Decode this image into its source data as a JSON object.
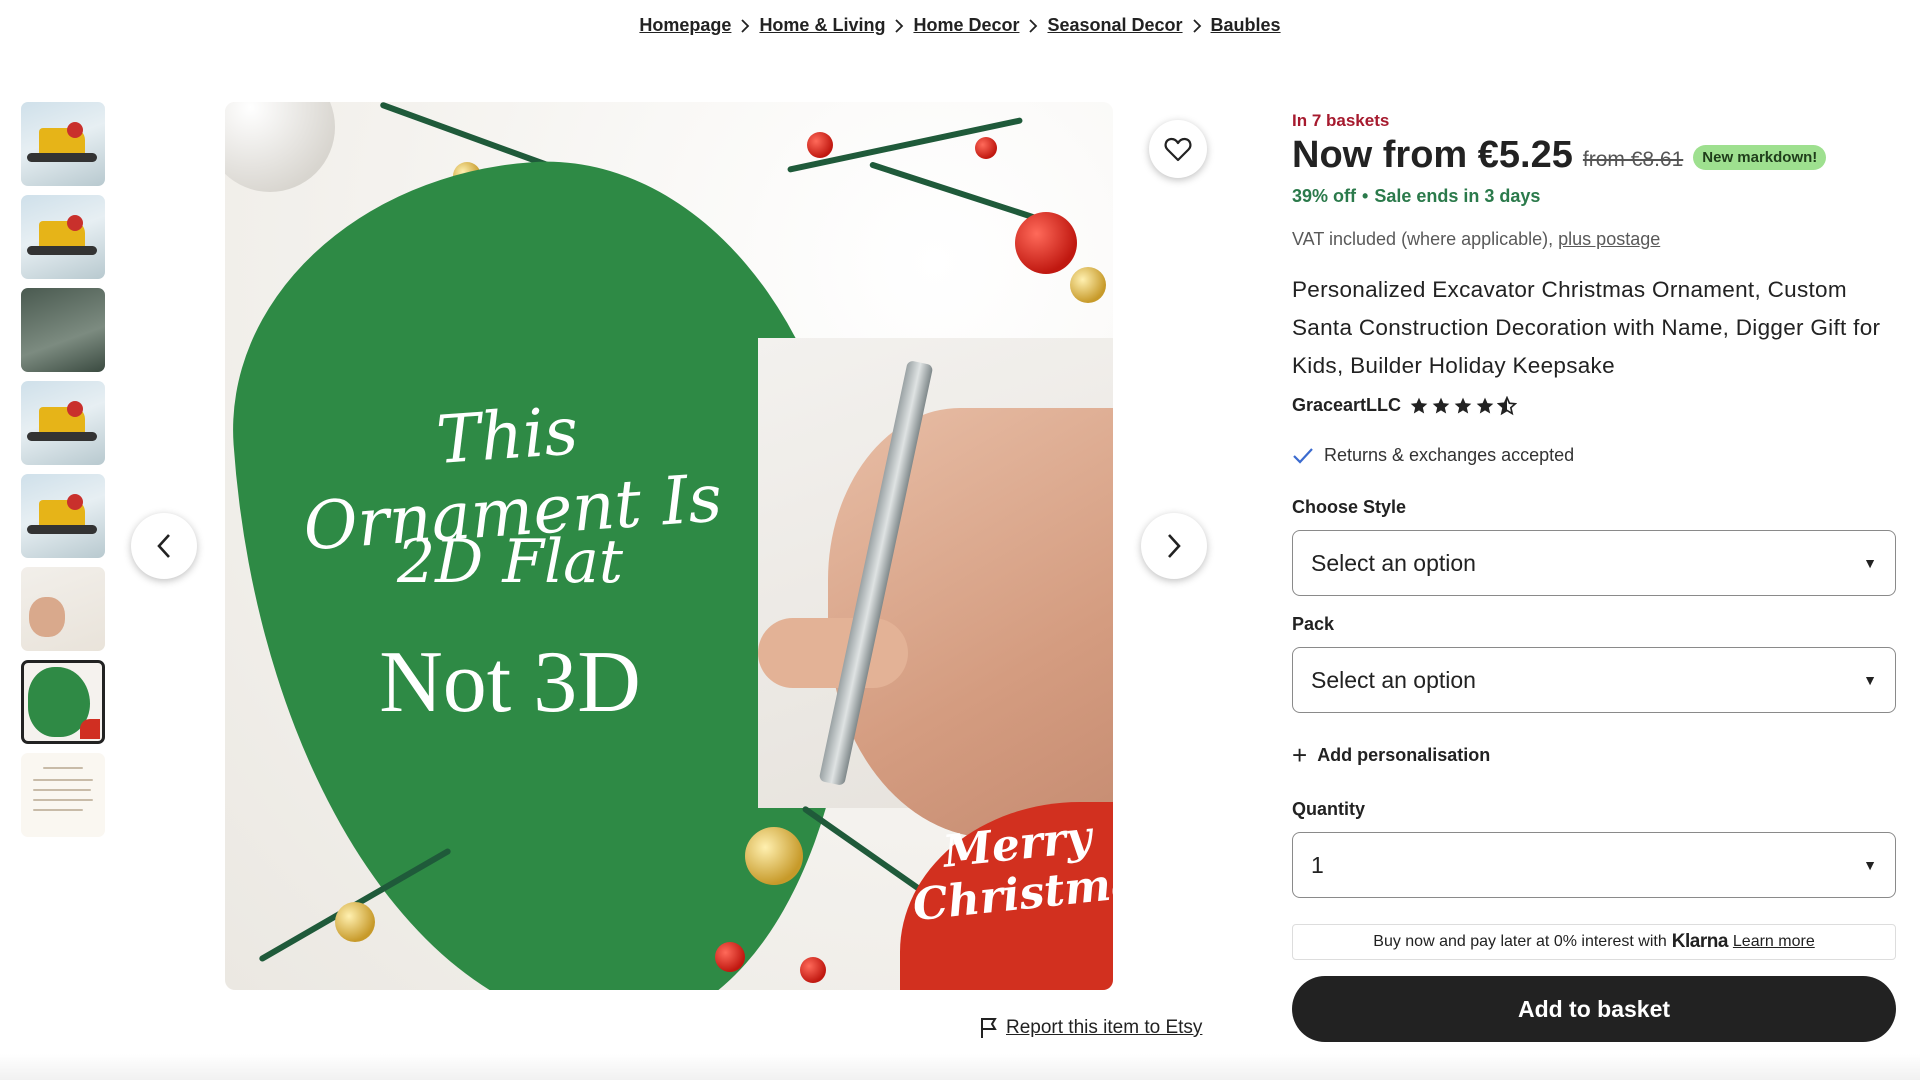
{
  "breadcrumb": [
    "Homepage",
    "Home & Living",
    "Home Decor",
    "Seasonal Decor",
    "Baubles"
  ],
  "gallery": {
    "thumbnail_count": 8,
    "selected_index": 7,
    "overlay_text": {
      "line1": "This Ornament Is",
      "line2": "2D Flat",
      "line3": "Not 3D",
      "corner": "Merry Christmas"
    }
  },
  "report_link": "Report this item to Etsy",
  "listing": {
    "baskets": "In 7 baskets",
    "price_now": "Now from €5.25",
    "price_old": "from €8.61",
    "markdown_badge": "New markdown!",
    "discount": "39% off",
    "sale_ends": "Sale ends in 3 days",
    "vat_text": "VAT included (where applicable),",
    "postage_link": "plus postage",
    "title": "Personalized Excavator Christmas Ornament, Custom Santa Construction Decoration with Name, Digger Gift for Kids, Builder Holiday Keepsake",
    "shop_name": "GraceartLLC",
    "rating": 4.5,
    "returns": "Returns & exchanges accepted",
    "style_label": "Choose Style",
    "style_value": "Select an option",
    "pack_label": "Pack",
    "pack_value": "Select an option",
    "personalisation": "Add personalisation",
    "quantity_label": "Quantity",
    "quantity_value": "1",
    "klarna_text": "Buy now and pay later at 0% interest with",
    "klarna_brand": "Klarna",
    "klarna_link": "Learn more",
    "add_to_basket": "Add to basket"
  },
  "colors": {
    "baskets_red": "#a61a2e",
    "sale_green": "#2b7a4b",
    "markdown_badge_bg": "#9ee08f",
    "button_dark": "#222222",
    "ornament_green": "#2e8a45",
    "ornament_red": "#d2301f"
  },
  "icons": [
    "chevron-right-icon",
    "heart-icon",
    "chevron-left-icon",
    "flag-icon",
    "star-icon",
    "checkmark-icon",
    "plus-icon",
    "caret-down-icon"
  ]
}
